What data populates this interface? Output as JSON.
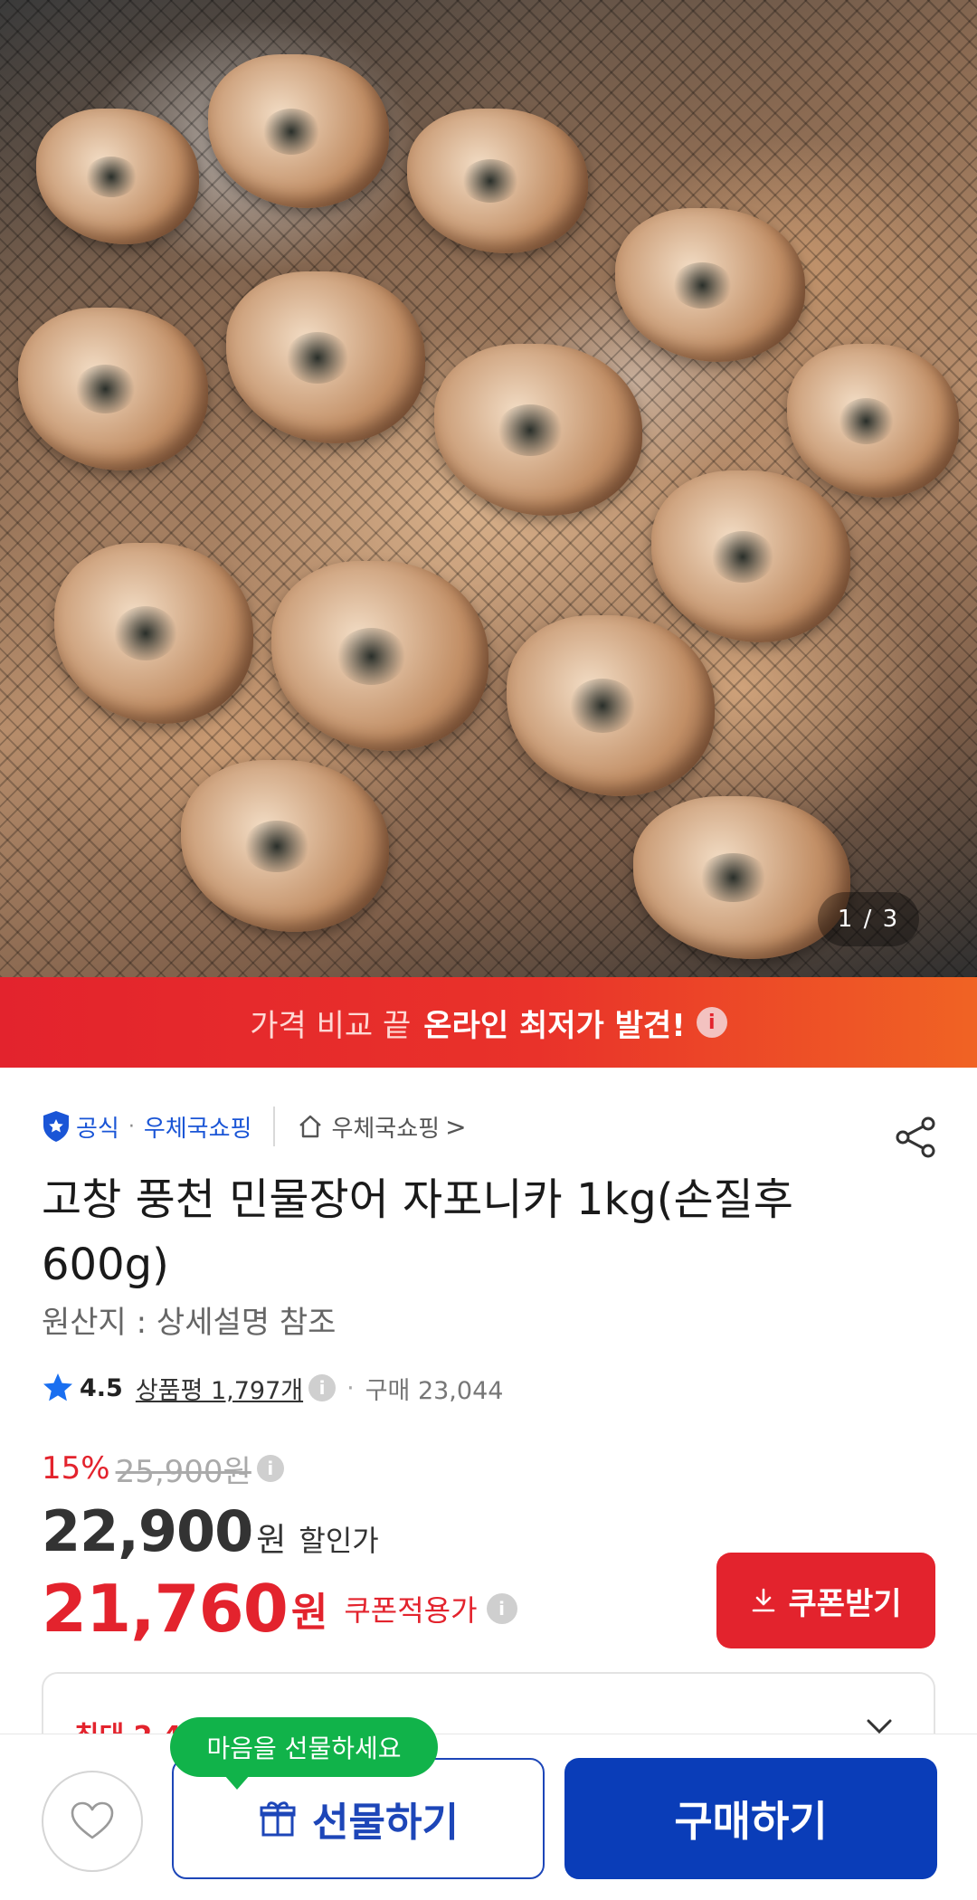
{
  "hero": {
    "counter": "1 / 3"
  },
  "promo": {
    "light_text": "가격 비교 끝",
    "bold_text": "온라인 최저가 발견!",
    "info_icon": "i"
  },
  "seller": {
    "official": "공식",
    "store": "우체국쇼핑",
    "store_link": "우체국쇼핑",
    "chevron": ">"
  },
  "product": {
    "title": "고창 풍천 민물장어 자포니카 1kg(손질후600g)",
    "origin": "원산지 : 상세설명 참조"
  },
  "rating": {
    "score": "4.5",
    "review_label": "상품평 1,797개",
    "purchase": "구매 23,044",
    "separator": "·"
  },
  "price": {
    "discount_pct": "15%",
    "original": "25,900원",
    "sale_amount": "22,900",
    "sale_currency": "원",
    "sale_label": "할인가",
    "coupon_amount": "21,760",
    "coupon_currency": "원",
    "coupon_label": "쿠폰적용가",
    "coupon_button": "쿠폰받기"
  },
  "benefit": {
    "peek_text": "최대 2,4"
  },
  "bottom_bar": {
    "gift_bubble": "마음을 선물하세요",
    "gift_button": "선물하기",
    "buy_button": "구매하기"
  },
  "colors": {
    "accent_red": "#e3232d",
    "brand_blue": "#0a3db8",
    "bubble_green": "#11b34a"
  },
  "icons": [
    "shield-icon",
    "home-icon",
    "share-icon",
    "star-icon",
    "info-icon",
    "download-icon",
    "heart-icon",
    "gift-icon",
    "chevron-down-icon"
  ]
}
